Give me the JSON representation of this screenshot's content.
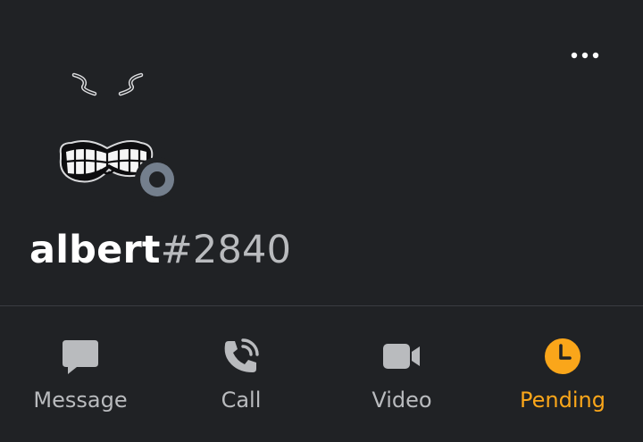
{
  "profile": {
    "username": "albert",
    "discriminator": "#2840",
    "status": "offline"
  },
  "header": {
    "more_icon": "ellipsis-icon"
  },
  "actions": [
    {
      "label": "Message",
      "icon": "message-icon",
      "color": "#b9bbbe"
    },
    {
      "label": "Call",
      "icon": "phone-call-icon",
      "color": "#b9bbbe"
    },
    {
      "label": "Video",
      "icon": "video-camera-icon",
      "color": "#b9bbbe"
    },
    {
      "label": "Pending",
      "icon": "clock-icon",
      "color": "#faa61a"
    }
  ],
  "colors": {
    "background": "#202225",
    "text_primary": "#ffffff",
    "text_muted": "#b9bbbe",
    "pending_accent": "#faa61a",
    "offline_status": "#747f8d"
  }
}
